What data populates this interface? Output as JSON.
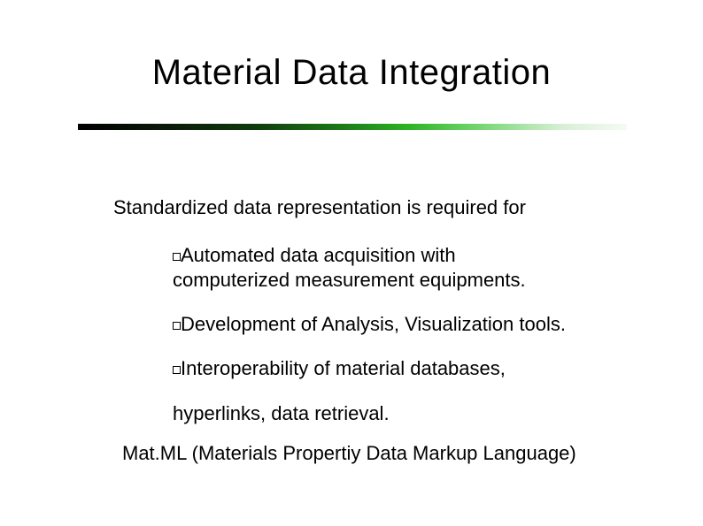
{
  "title": "Material Data Integration",
  "lead": "Standardized data representation is required for",
  "bullets": {
    "b1_line1": "Automated data acquisition with",
    "b1_line2": "computerized measurement equipments.",
    "b2": "Development of Analysis, Visualization tools.",
    "b3_line1": "Interoperability of material databases,",
    "b3_line2": "hyperlinks, data retrieval."
  },
  "closing": "Mat.ML (Materials Propertiy Data Markup Language)"
}
